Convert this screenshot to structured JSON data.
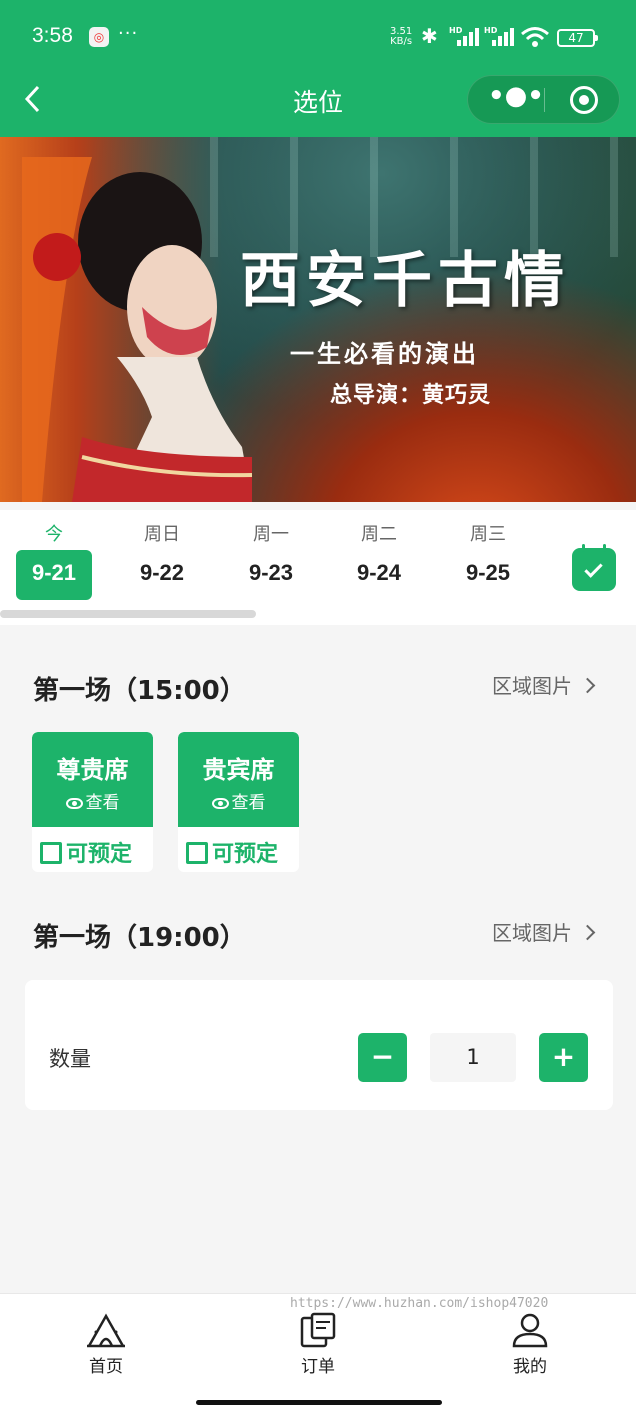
{
  "status_bar": {
    "time": "3:58",
    "net_speed_top": "3.51",
    "net_speed_unit": "KB/s",
    "signal_label": "HD",
    "battery": "47"
  },
  "nav": {
    "title": "选位",
    "back_icon": "chevron-left-icon",
    "menu_icon": "more-dots-icon",
    "close_icon": "target-circle-icon"
  },
  "banner": {
    "title": "西安千古情",
    "subtitle": "一生必看的演出",
    "director": "总导演：黄巧灵"
  },
  "dates": [
    {
      "weekday": "今",
      "date": "9-21",
      "active": true
    },
    {
      "weekday": "周日",
      "date": "9-22",
      "active": false
    },
    {
      "weekday": "周一",
      "date": "9-23",
      "active": false
    },
    {
      "weekday": "周二",
      "date": "9-24",
      "active": false
    },
    {
      "weekday": "周三",
      "date": "9-25",
      "active": false
    }
  ],
  "sessions": [
    {
      "title": "第一场（15:00）",
      "area_link": "区域图片",
      "seats": [
        {
          "name": "尊贵席",
          "view": "查看",
          "status": "可预定"
        },
        {
          "name": "贵宾席",
          "view": "查看",
          "status": "可预定"
        }
      ]
    },
    {
      "title": "第一场（19:00）",
      "area_link": "区域图片"
    }
  ],
  "quantity": {
    "label": "数量",
    "minus": "−",
    "value": "1",
    "plus": "+"
  },
  "watermark": "https://www.huzhan.com/ishop47020",
  "tabbar": [
    {
      "label": "首页",
      "icon": "home-tent-icon"
    },
    {
      "label": "订单",
      "icon": "ticket-icon"
    },
    {
      "label": "我的",
      "icon": "user-icon"
    }
  ],
  "colors": {
    "brand": "#1db36a",
    "background": "#f5f5f5"
  }
}
